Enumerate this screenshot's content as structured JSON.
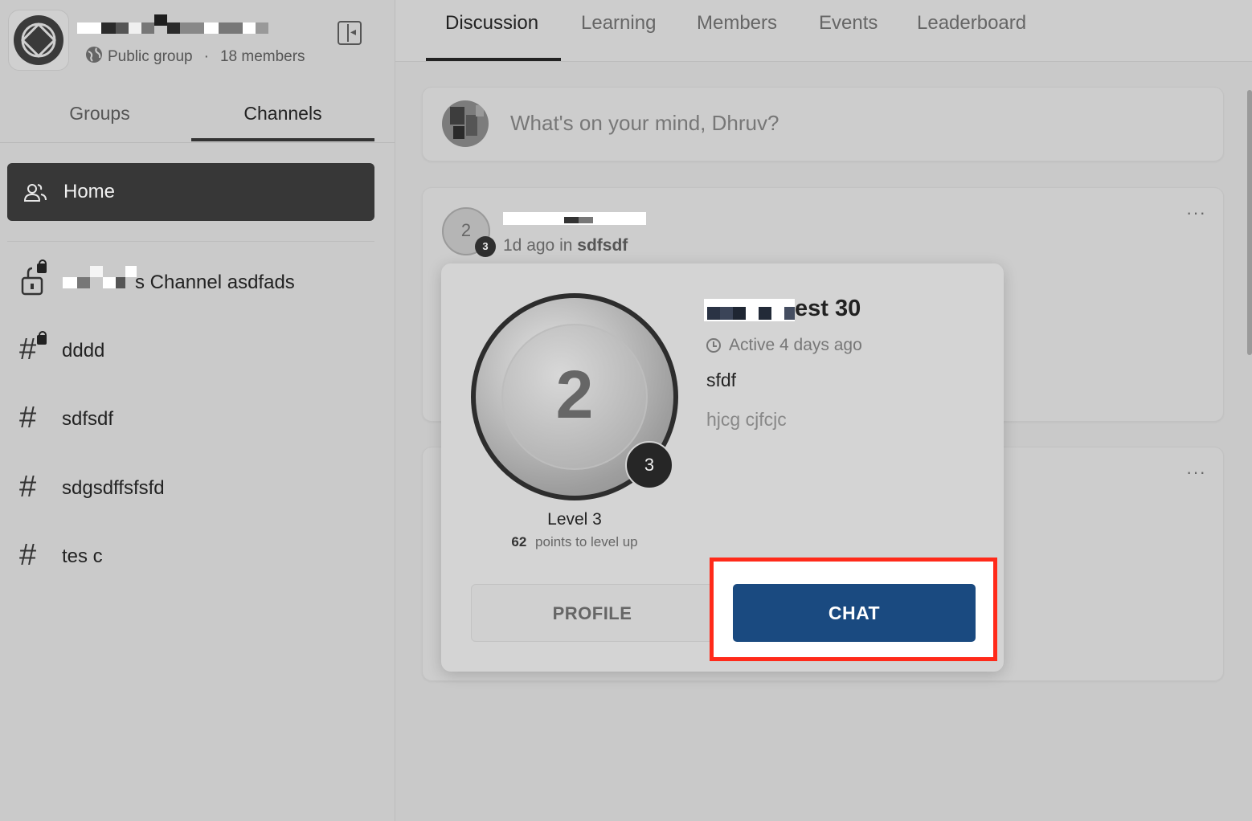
{
  "group": {
    "visibility": "Public group",
    "members": "18 members",
    "separator": "·"
  },
  "sidebar": {
    "tabs": [
      "Groups",
      "Channels"
    ],
    "home_label": "Home",
    "channels": [
      {
        "name": "s Channel asdfads",
        "icon": "hash-lock-icon"
      },
      {
        "name": "dddd",
        "icon": "hash-lock-icon"
      },
      {
        "name": "sdfsdf",
        "icon": "hash-icon"
      },
      {
        "name": "sdgsdffsfsfd",
        "icon": "hash-icon"
      },
      {
        "name": "tes c",
        "icon": "hash-icon"
      }
    ]
  },
  "nav": {
    "tabs": [
      "Discussion",
      "Learning",
      "Members",
      "Events",
      "Leaderboard"
    ],
    "active": "Discussion"
  },
  "composer": {
    "placeholder": "What's on your mind, Dhruv?"
  },
  "post": {
    "avatar_level": "2",
    "level_badge": "3",
    "time": "1d ago in",
    "channel": "sdfsdf",
    "more": "···"
  },
  "popover": {
    "name_suffix": "est 30",
    "active": "Active 4 days ago",
    "bio": "sfdf",
    "extra": "hjcg cjfcjc",
    "badge_level": "2",
    "badge_small": "3",
    "level_label": "Level 3",
    "points": "62",
    "points_label": "points to level up",
    "profile_button": "PROFILE",
    "chat_button": "CHAT"
  },
  "colors": {
    "chat_button": "#1a4a80",
    "highlight_border": "#ff2a1a",
    "home_active_bg": "#373737"
  }
}
